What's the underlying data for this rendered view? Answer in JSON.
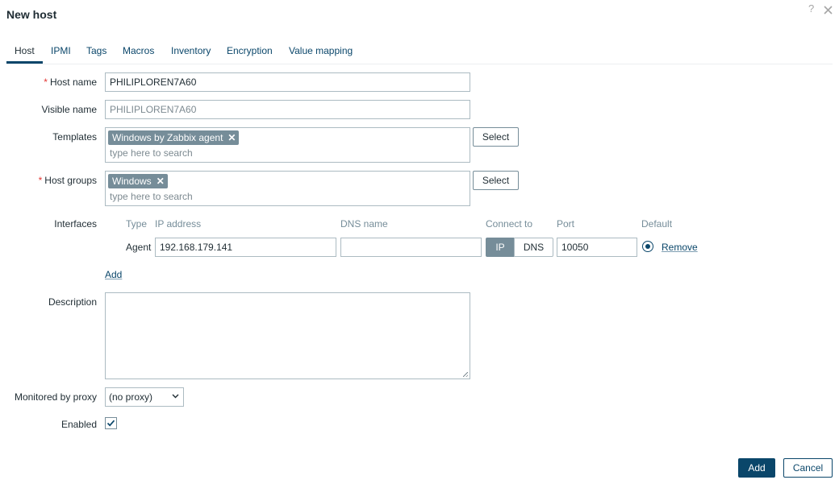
{
  "dialog": {
    "title": "New host",
    "help_icon": "question-mark",
    "close_icon": "close-x"
  },
  "tabs": [
    {
      "label": "Host",
      "active": true
    },
    {
      "label": "IPMI"
    },
    {
      "label": "Tags"
    },
    {
      "label": "Macros"
    },
    {
      "label": "Inventory"
    },
    {
      "label": "Encryption"
    },
    {
      "label": "Value mapping"
    }
  ],
  "form": {
    "host_name": {
      "label": "Host name",
      "required": true,
      "value": "PHILIPLOREN7A60"
    },
    "visible_name": {
      "label": "Visible name",
      "placeholder": "PHILIPLOREN7A60"
    },
    "templates": {
      "label": "Templates",
      "chips": [
        "Windows by Zabbix agent"
      ],
      "placeholder": "type here to search",
      "select_label": "Select"
    },
    "host_groups": {
      "label": "Host groups",
      "required": true,
      "chips": [
        "Windows"
      ],
      "placeholder": "type here to search",
      "select_label": "Select"
    },
    "interfaces": {
      "label": "Interfaces",
      "columns": {
        "type": "Type",
        "ip": "IP address",
        "dns": "DNS name",
        "connect": "Connect to",
        "port": "Port",
        "default": "Default"
      },
      "rows": [
        {
          "type": "Agent",
          "ip": "192.168.179.141",
          "dns": "",
          "connect_ip": "IP",
          "connect_dns": "DNS",
          "connect_selected": "IP",
          "port": "10050",
          "default_selected": true,
          "remove_label": "Remove"
        }
      ],
      "add_label": "Add"
    },
    "description": {
      "label": "Description",
      "value": ""
    },
    "proxy": {
      "label": "Monitored by proxy",
      "value": "(no proxy)"
    },
    "enabled": {
      "label": "Enabled",
      "checked": true
    }
  },
  "footer": {
    "add_label": "Add",
    "cancel_label": "Cancel"
  },
  "colors": {
    "accent": "#0a466a",
    "chip": "#768d99",
    "required": "#e33734"
  }
}
